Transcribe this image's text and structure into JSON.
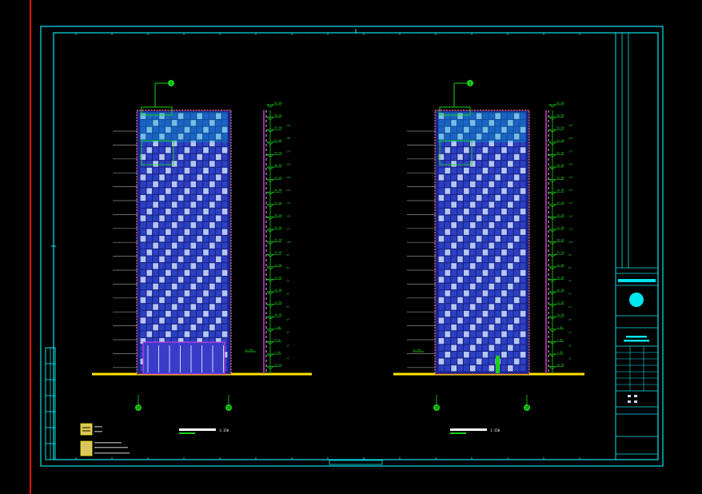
{
  "colors": {
    "background": "#000000",
    "frame": "#00e5ee",
    "facade_outline": "#e06060",
    "glass": "#2f44c8",
    "grid_blue": "#5a6cff",
    "window_light": "#c8d8ff",
    "green": "#19d219",
    "yellow": "#ffe600",
    "magenta": "#e040e0",
    "red_line": "#e01010",
    "grey_line": "#8c8c8c",
    "white": "#ffffff"
  },
  "elevations": [
    {
      "id": "left",
      "axis_top": "1",
      "axis_bottom_left": "24",
      "axis_bottom_right": "18",
      "scale": "1:150",
      "entrance_label": "0.150"
    },
    {
      "id": "right",
      "axis_top": "1",
      "axis_bottom_left": "18",
      "axis_bottom_right": "24",
      "scale": "1:150",
      "entrance_label": "0.150"
    }
  ],
  "levels": [
    "61.80",
    "58.80",
    "55.80",
    "52.80",
    "49.80",
    "46.80",
    "43.80",
    "40.80",
    "37.80",
    "34.80",
    "31.80",
    "28.80",
    "25.80",
    "22.80",
    "19.80",
    "16.80",
    "13.80",
    "10.80",
    "7.80",
    "4.80",
    "1.80",
    "±0.00"
  ],
  "storeys": [
    "19F",
    "18F",
    "17F",
    "16F",
    "15F",
    "14F",
    "13F",
    "12F",
    "11F",
    "10F",
    "9F",
    "8F",
    "7F",
    "6F",
    "5F",
    "4F",
    "3F",
    "2F",
    "1F"
  ]
}
